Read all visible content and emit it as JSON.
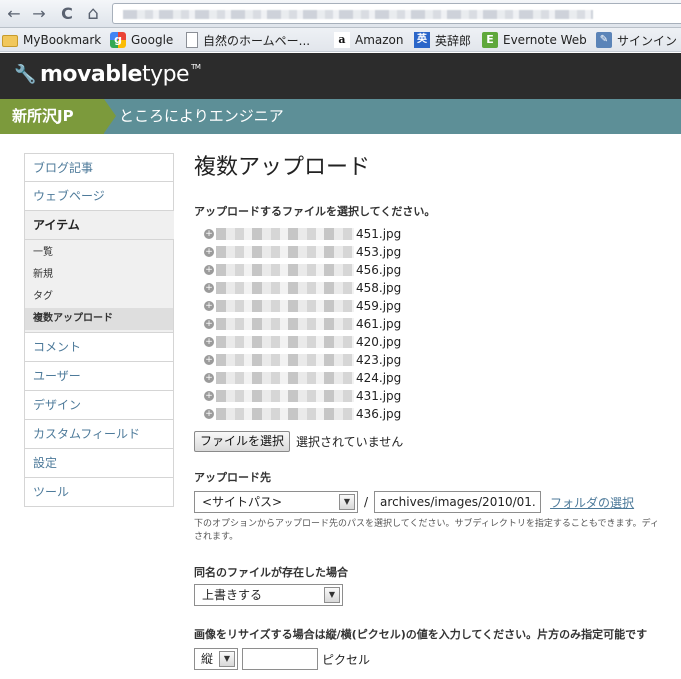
{
  "browser": {
    "nav": {
      "back": "←",
      "forward": "→",
      "reload": "C",
      "home": "⌂"
    },
    "bookmarks": [
      {
        "label": "MyBookmark",
        "icon": "folder-icon"
      },
      {
        "label": "Google",
        "icon": "google-icon"
      },
      {
        "label": "自然のホームペー...",
        "icon": "page-icon"
      },
      {
        "label": "Amazon",
        "icon": "amazon-icon"
      },
      {
        "label": "英辞郎",
        "icon": "eijiro-icon"
      },
      {
        "label": "Evernote Web",
        "icon": "evernote-icon"
      },
      {
        "label": "サインイン",
        "icon": "signin-icon"
      }
    ]
  },
  "app": {
    "logo_bold": "movable",
    "logo_light": "type",
    "logo_tm": "TM",
    "site_name": "新所沢JP",
    "blog_name": "ところによりエンジニア"
  },
  "sidebar": {
    "items": [
      "ブログ記事",
      "ウェブページ",
      "アイテム"
    ],
    "submenu": [
      "一覧",
      "新規",
      "タグ",
      "複数アップロード"
    ],
    "items_after": [
      "コメント",
      "ユーザー",
      "デザイン",
      "カスタムフィールド",
      "設定",
      "ツール"
    ]
  },
  "main": {
    "title": "複数アップロード",
    "select_files_label": "アップロードするファイルを選択してください。",
    "files": [
      "451.jpg",
      "453.jpg",
      "456.jpg",
      "458.jpg",
      "459.jpg",
      "461.jpg",
      "420.jpg",
      "423.jpg",
      "424.jpg",
      "431.jpg",
      "436.jpg"
    ],
    "file_button": "ファイルを選択",
    "file_status": "選択されていません",
    "destination_label": "アップロード先",
    "destination_select": "<サイトパス>",
    "destination_slash": "/",
    "destination_path": "archives/images/2010/01.",
    "folder_link": "フォルダの選択",
    "destination_hint": "下のオプションからアップロード先のパスを選択してください。サブディレクトリを指定することもできます。ディ\nされます。",
    "exists_label": "同名のファイルが存在した場合",
    "exists_select": "上書きする",
    "resize_label": "画像をリサイズする場合は縦/横(ピクセル)の値を入力してください。片方のみ指定可能です",
    "resize_select": "縦",
    "resize_value": "",
    "resize_unit": "ピクセル"
  },
  "colors": {
    "header_bg": "#2c2c2c",
    "blog_bar": "#5d8f97",
    "site_tab": "#7c9a3c",
    "link": "#4d7a9a"
  }
}
